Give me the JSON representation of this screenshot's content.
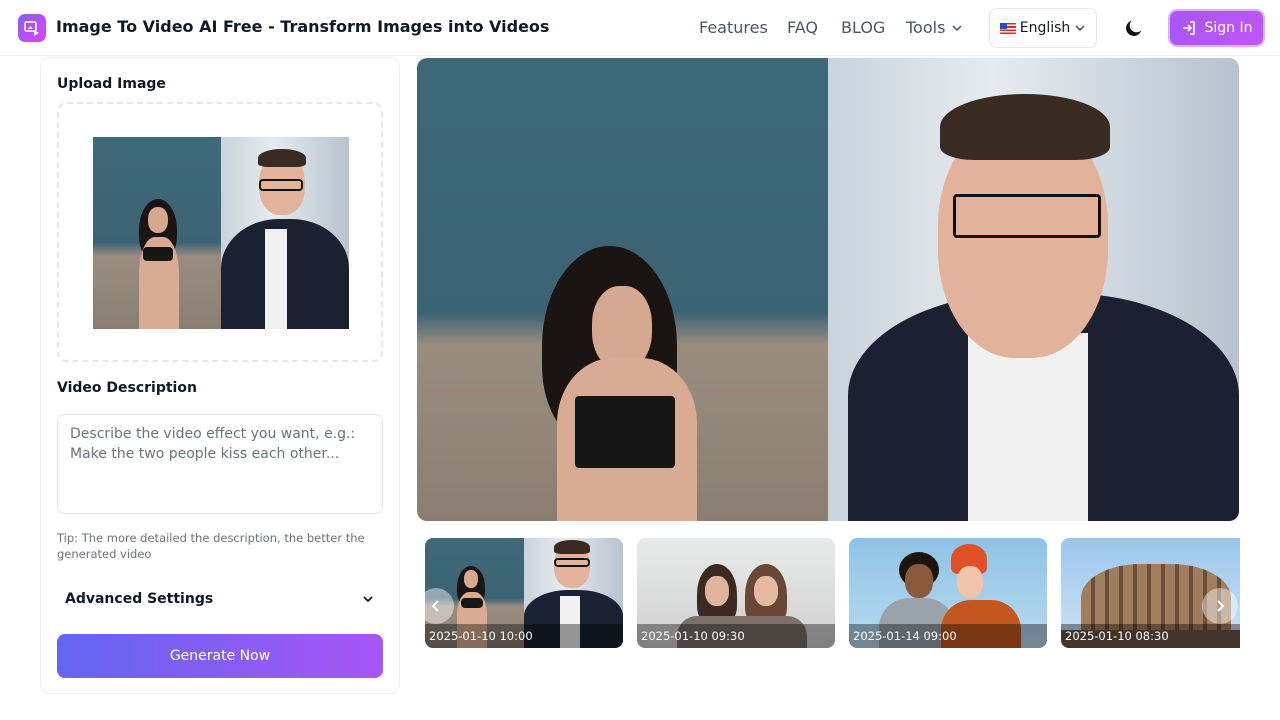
{
  "header": {
    "site_title": "Image To Video AI Free - Transform Images into Videos",
    "nav": {
      "features": "Features",
      "faq": "FAQ",
      "blog": "BLOG",
      "tools": "Tools"
    },
    "language": "English",
    "sign_in": "Sign In"
  },
  "form": {
    "upload_label": "Upload Image",
    "description_label": "Video Description",
    "description_placeholder": "Describe the video effect you want, e.g.: Make the two people kiss each other...",
    "description_value": "",
    "tip": "Tip: The more detailed the description, the better the generated video",
    "advanced_settings": "Advanced Settings",
    "generate_button": "Generate Now"
  },
  "gallery": {
    "items": [
      {
        "timestamp": "2025-01-10 10:00"
      },
      {
        "timestamp": "2025-01-10 09:30"
      },
      {
        "timestamp": "2025-01-14 09:00"
      },
      {
        "timestamp": "2025-01-10 08:30"
      }
    ]
  },
  "colors": {
    "accent": "#a855f7",
    "generate_gradient_start": "#6366f1",
    "generate_gradient_end": "#a855f7"
  }
}
